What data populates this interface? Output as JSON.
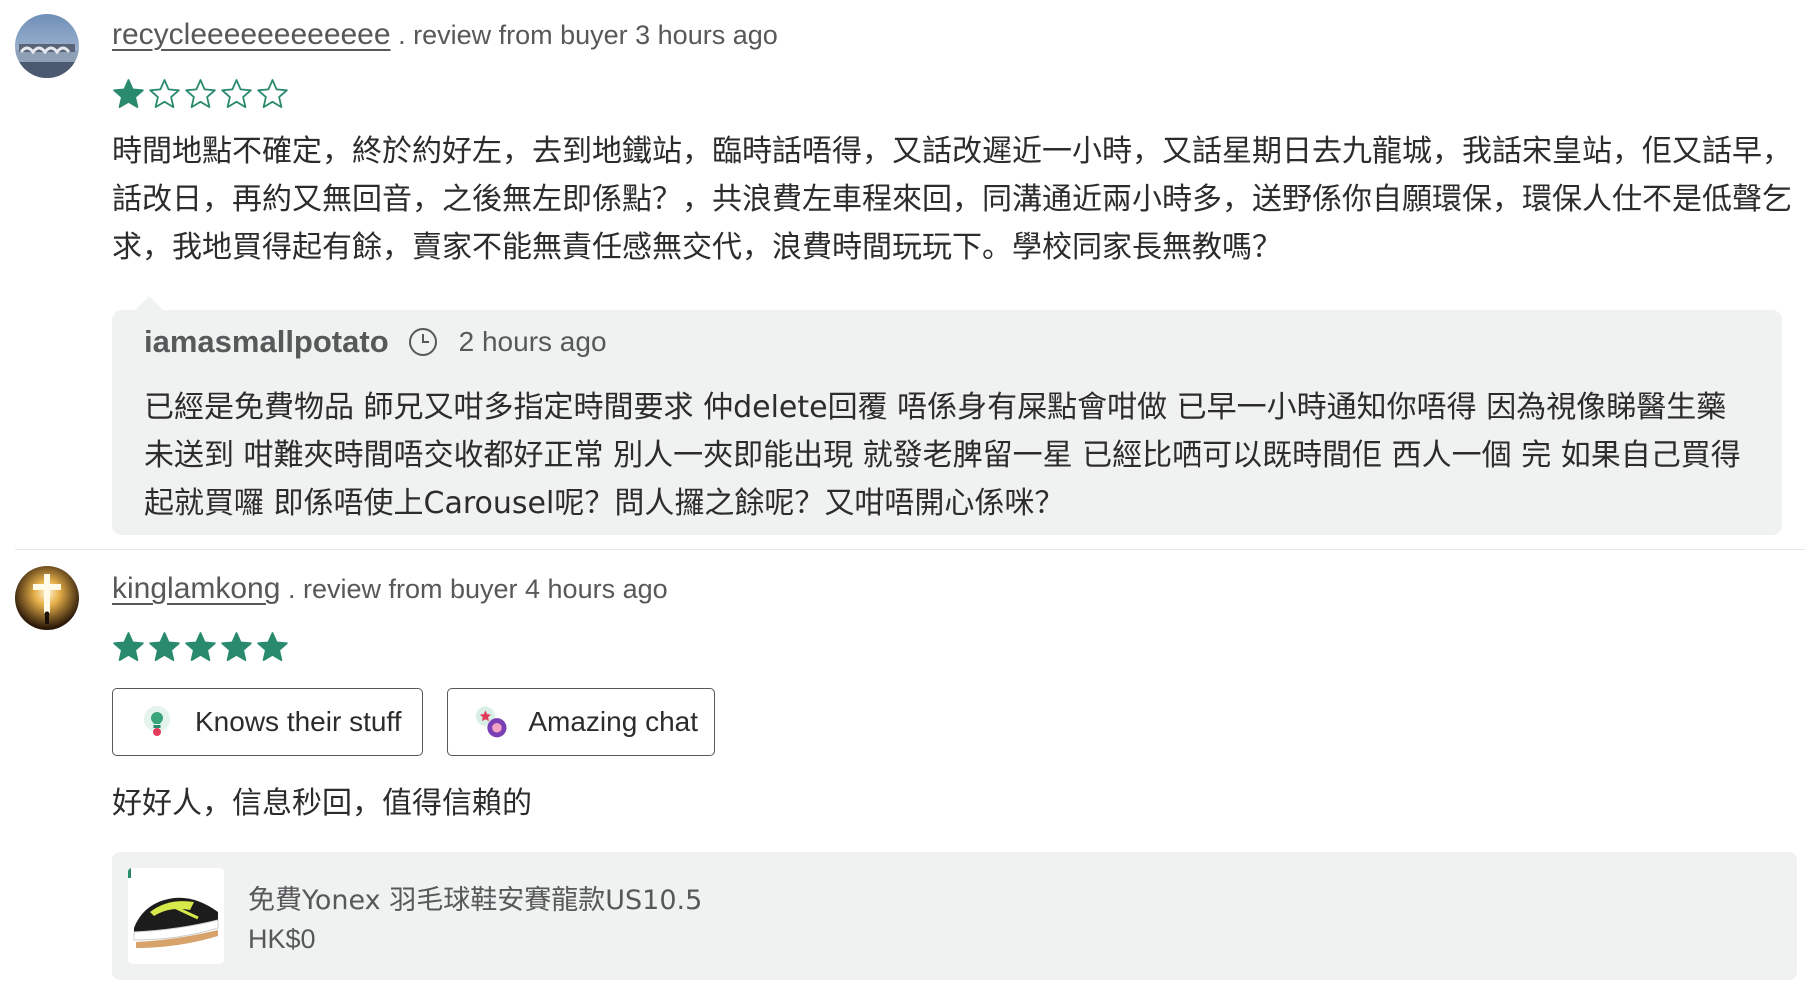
{
  "reviews": [
    {
      "username": "recycleeeeeeeeeeee",
      "meta": ". review from buyer 3 hours ago",
      "rating": 1,
      "text": "時間地點不確定，終於約好左，去到地鐵站，臨時話唔得，又話改遲近一小時，又話星期日去九龍城，我話宋皇站，佢又話早，話改日，再約又無回音，之後無左即係點？，共浪費左車程來回，同溝通近兩小時多，送野係你自願環保，環保人仕不是低聲乞求，我地買得起有餘，賣家不能無責任感無交代，浪費時間玩玩下。學校同家長無教嗎？",
      "reply": {
        "username": "iamasmallpotato",
        "time": "2 hours ago",
        "text": "已經是免費物品 師兄又咁多指定時間要求 仲delete回覆 唔係身有屎點會咁做 已早一小時通知你唔得 因為視像睇醫生藥未送到 咁難夾時間唔交收都好正常 別人一夾即能出現 就發老脾留一星 已經比哂可以既時間佢 西人一個 完 如果自己買得起就買囉 即係唔使上Carousel呢？問人攞之餘呢？又咁唔開心係咪？"
      }
    },
    {
      "username": "kinglamkong",
      "meta": ". review from buyer 4 hours ago",
      "rating": 5,
      "tags": [
        "Knows their stuff",
        "Amazing chat"
      ],
      "text": "好好人，信息秒回，值得信賴的",
      "listing": {
        "title": "免費Yonex 羽毛球鞋安賽龍款US10.5",
        "price": "HK$0"
      }
    }
  ],
  "colors": {
    "star": "#2a8a6e",
    "reply_bg": "#f0f1f1",
    "muted_text": "#57585a"
  }
}
